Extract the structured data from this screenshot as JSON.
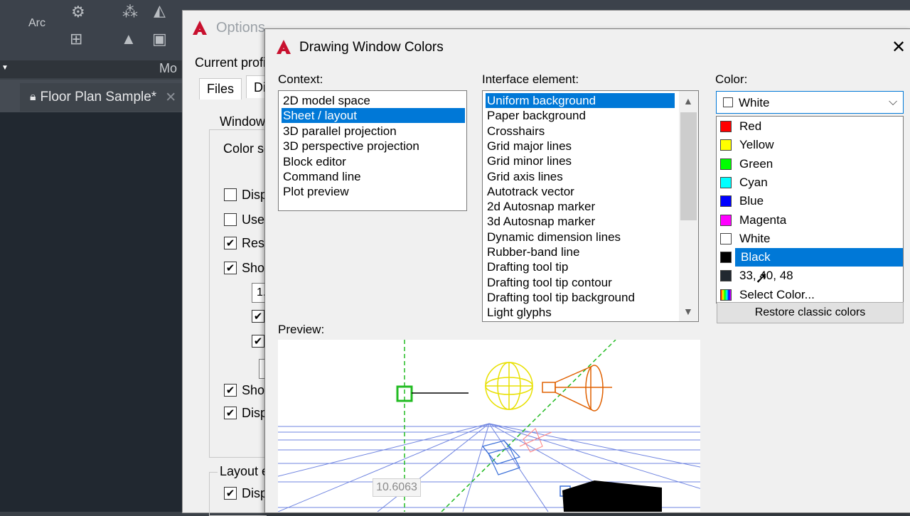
{
  "background_app": {
    "ribbon_label_arc": "Arc",
    "ribbon_label_mo": "Mo",
    "doc_tab": "Floor Plan Sample*"
  },
  "options_dialog": {
    "title": "Options",
    "current_profile_label": "Current profi",
    "tabs": [
      "Files",
      "Di"
    ],
    "window_group": "Window",
    "color_scheme_label": "Color sc",
    "checkboxes": [
      {
        "label": "Disp",
        "checked": false
      },
      {
        "label": "Use",
        "checked": false
      },
      {
        "label": "Res",
        "checked": true
      },
      {
        "label": "Sho",
        "checked": true
      }
    ],
    "field_value": "1.",
    "checkboxes2": [
      {
        "label": "Sho",
        "checked": true
      },
      {
        "label": "Disp",
        "checked": true
      }
    ],
    "layout_group": "Layout e",
    "checkboxes3": [
      {
        "label": "Disp",
        "checked": true
      }
    ]
  },
  "dwc": {
    "title": "Drawing Window Colors",
    "close": "✕",
    "context_label": "Context:",
    "context_items": [
      "2D model space",
      "Sheet / layout",
      "3D parallel projection",
      "3D perspective projection",
      "Block editor",
      "Command line",
      "Plot preview"
    ],
    "context_selected": 1,
    "interface_label": "Interface element:",
    "interface_items": [
      "Uniform background",
      "Paper background",
      "Crosshairs",
      "Grid major lines",
      "Grid minor lines",
      "Grid axis lines",
      "Autotrack vector",
      "2d Autosnap marker",
      "3d Autosnap marker",
      "Dynamic dimension lines",
      "Rubber-band line",
      "Drafting tool tip",
      "Drafting tool tip contour",
      "Drafting tool tip background",
      "Light glyphs"
    ],
    "interface_selected": 0,
    "color_label": "Color:",
    "color_value": "White",
    "color_options": [
      {
        "label": "Red",
        "color": "#ff0000"
      },
      {
        "label": "Yellow",
        "color": "#ffff00"
      },
      {
        "label": "Green",
        "color": "#00ff00"
      },
      {
        "label": "Cyan",
        "color": "#00ffff"
      },
      {
        "label": "Blue",
        "color": "#0000ff"
      },
      {
        "label": "Magenta",
        "color": "#ff00ff"
      },
      {
        "label": "White",
        "color": "#ffffff"
      },
      {
        "label": "Black",
        "color": "#000000"
      },
      {
        "label": "33, 40, 48",
        "color": "#212830"
      },
      {
        "label": "Select Color...",
        "color": "spectrum"
      }
    ],
    "color_highlighted": 7,
    "restore_label": "Restore classic colors",
    "preview_label": "Preview:",
    "dimension_value": "10.6063"
  },
  "colors": {
    "accent": "#0078d7",
    "grid_blue": "#6f84e0",
    "crosshair_green": "#22bb22",
    "light_yellow": "#e8e000",
    "spot_orange": "#e06000"
  }
}
